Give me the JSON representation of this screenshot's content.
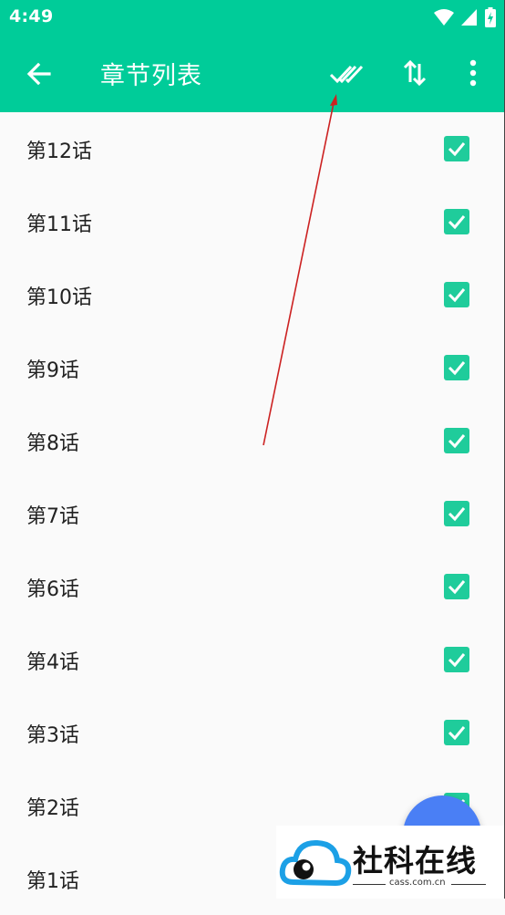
{
  "statusbar": {
    "time": "4:49",
    "icons": [
      "wifi-icon",
      "signal-icon",
      "battery-charging-icon"
    ]
  },
  "appbar": {
    "title": "章节列表",
    "back_icon": "arrow-back-icon",
    "actions": [
      "select-all-double-check-icon",
      "sort-swap-vertical-icon",
      "more-vertical-icon"
    ]
  },
  "chapters": [
    {
      "label": "第12话",
      "checked": true
    },
    {
      "label": "第11话",
      "checked": true
    },
    {
      "label": "第10话",
      "checked": true
    },
    {
      "label": "第9话",
      "checked": true
    },
    {
      "label": "第8话",
      "checked": true
    },
    {
      "label": "第7话",
      "checked": true
    },
    {
      "label": "第6话",
      "checked": true
    },
    {
      "label": "第4话",
      "checked": true
    },
    {
      "label": "第3话",
      "checked": true
    },
    {
      "label": "第2话",
      "checked": true
    },
    {
      "label": "第1话",
      "checked": true
    }
  ],
  "watermark": {
    "text": "社科在线",
    "url": "cass.com.cn"
  },
  "colors": {
    "primary": "#00cc99",
    "checkbox": "#1fcc9b",
    "fab": "#4a7ff5",
    "annotation_arrow": "#cc2222"
  }
}
